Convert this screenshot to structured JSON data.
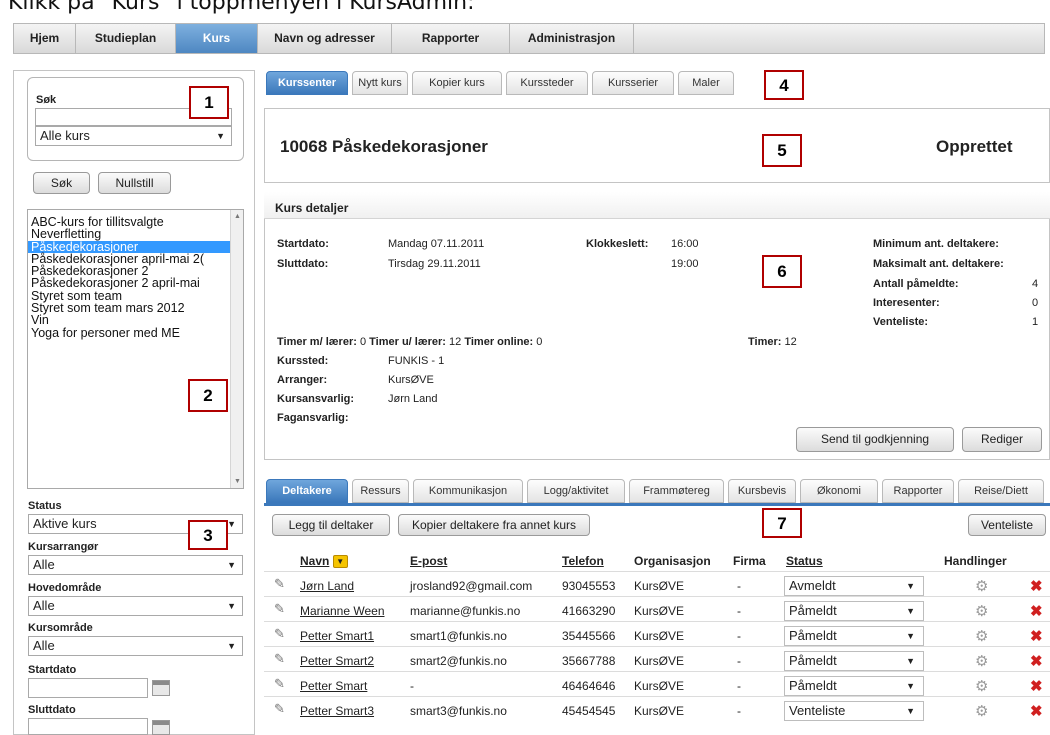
{
  "caption": "Klikk på \"Kurs\" i toppmenyen i KursAdmin:",
  "topmenu": [
    "Hjem",
    "Studieplan",
    "Kurs",
    "Navn og adresser",
    "Rapporter",
    "Administrasjon"
  ],
  "search": {
    "label": "Søk",
    "scope_value": "Alle kurs",
    "search_btn": "Søk",
    "reset_btn": "Nullstill"
  },
  "course_list": [
    "ABC-kurs for tillitsvalgte",
    "Neverfletting",
    "Påskedekorasjoner",
    "Påskedekorasjoner april-mai 2(",
    "Påskedekorasjoner 2",
    "Påskedekorasjoner 2 april-mai",
    "Styret som team",
    "Styret som team mars 2012",
    "Vin",
    "Yoga for personer med ME"
  ],
  "filters": {
    "status_label": "Status",
    "status_value": "Aktive kurs",
    "arranger_label": "Kursarrangør",
    "arranger_value": "Alle",
    "hoved_label": "Hovedområde",
    "hoved_value": "Alle",
    "omrade_label": "Kursområde",
    "omrade_value": "Alle",
    "start_label": "Startdato",
    "slutt_label": "Sluttdato"
  },
  "numbers": [
    "1",
    "2",
    "3",
    "4",
    "5",
    "6",
    "7"
  ],
  "course_tabs": [
    "Kurssenter",
    "Nytt kurs",
    "Kopier kurs",
    "Kurssteder",
    "Kursserier",
    "Maler"
  ],
  "course": {
    "title": "10068 Påskedekorasjoner",
    "state": "Opprettet"
  },
  "details": {
    "header": "Kurs detaljer",
    "start_label": "Startdato:",
    "start_value": "Mandag 07.11.2011",
    "end_label": "Sluttdato:",
    "end_value": "Tirsdag 29.11.2011",
    "time_label": "Klokkeslett:",
    "time_start": "16:00",
    "time_end": "19:00",
    "min_label": "Minimum ant. deltakere:",
    "max_label": "Maksimalt ant. deltakere:",
    "paameldte_label": "Antall påmeldte:",
    "paameldte_value": "4",
    "interessenter_label": "Interesenter:",
    "interessenter_value": "0",
    "venteliste_label": "Venteliste:",
    "venteliste_value": "1",
    "timer_m_label": "Timer m/ lærer:",
    "timer_m_value": "0",
    "timer_u_label": "Timer u/ lærer:",
    "timer_u_value": "12",
    "timer_o_label": "Timer online:",
    "timer_o_value": "0",
    "timer_label": "Timer:",
    "timer_value": "12",
    "sted_label": "Kurssted:",
    "sted_value": "FUNKIS - 1",
    "arr_label": "Arranger:",
    "arr_value": "KursØVE",
    "ansv_label": "Kursansvarlig:",
    "ansv_value": "Jørn Land",
    "fag_label": "Fagansvarlig:",
    "send_btn": "Send til godkjenning",
    "edit_btn": "Rediger"
  },
  "participant_tabs": [
    "Deltakere",
    "Ressurs",
    "Kommunikasjon",
    "Logg/aktivitet",
    "Frammøtereg",
    "Kursbevis",
    "Økonomi",
    "Rapporter",
    "Reise/Diett"
  ],
  "participants": {
    "add_btn": "Legg til deltaker",
    "copy_btn": "Kopier deltakere fra annet kurs",
    "waitlist_btn": "Venteliste",
    "headers": [
      "Navn",
      "E-post",
      "Telefon",
      "Organisasjon",
      "Firma",
      "Status",
      "Handlinger"
    ],
    "rows": [
      {
        "name": "Jørn Land",
        "email": "jrosland92@gmail.com",
        "phone": "93045553",
        "org": "KursØVE",
        "firm": "-",
        "status": "Avmeldt"
      },
      {
        "name": "Marianne Ween",
        "email": "marianne@funkis.no",
        "phone": "41663290",
        "org": "KursØVE",
        "firm": "-",
        "status": "Påmeldt"
      },
      {
        "name": "Petter Smart1",
        "email": "smart1@funkis.no",
        "phone": "35445566",
        "org": "KursØVE",
        "firm": "-",
        "status": "Påmeldt"
      },
      {
        "name": "Petter Smart2",
        "email": "smart2@funkis.no",
        "phone": "35667788",
        "org": "KursØVE",
        "firm": "-",
        "status": "Påmeldt"
      },
      {
        "name": "Petter Smart",
        "email": "-",
        "phone": "46464646",
        "org": "KursØVE",
        "firm": "-",
        "status": "Påmeldt"
      },
      {
        "name": "Petter Smart3",
        "email": "smart3@funkis.no",
        "phone": "45454545",
        "org": "KursØVE",
        "firm": "-",
        "status": "Venteliste"
      }
    ]
  },
  "colors": {
    "accent": "#4e87c2",
    "selection": "#3399ff",
    "marker_border": "#b00000",
    "delete": "#d02020"
  },
  "icons": {
    "edit": "pencil-icon",
    "settings": "gear-icon",
    "delete": "delete-x-icon",
    "calendar": "calendar-icon",
    "sort": "sort-dropdown-icon"
  }
}
